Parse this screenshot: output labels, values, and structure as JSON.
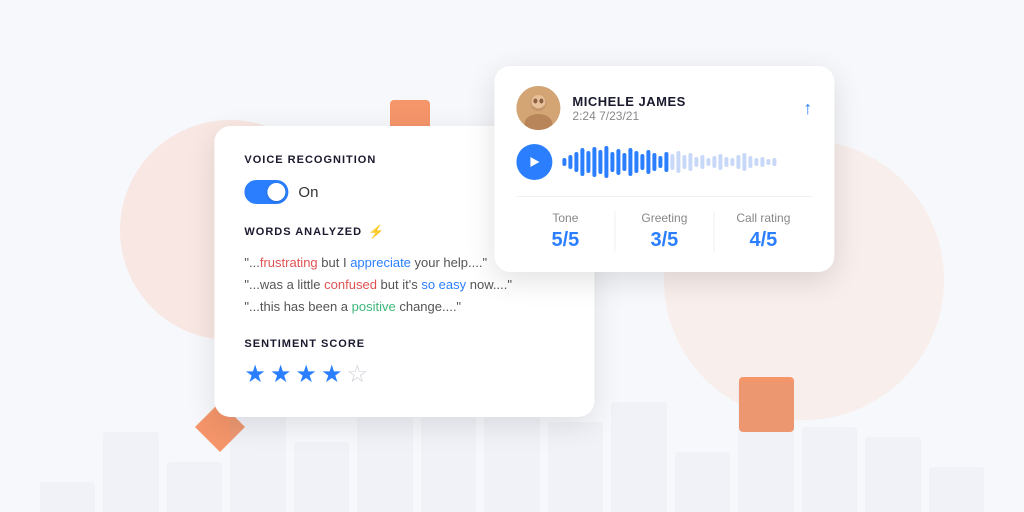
{
  "background": {
    "bars": [
      30,
      80,
      50,
      120,
      70,
      160,
      100,
      140,
      90,
      110,
      60,
      130,
      85,
      75,
      45
    ]
  },
  "voice_card": {
    "title": "VOICE RECOGNITION",
    "toggle_state": "on",
    "toggle_label": "On",
    "words_section_title": "WORDS ANALYZED",
    "words": [
      {
        "id": 0,
        "text": "\"...frustrating but I appreciate your help....\""
      },
      {
        "id": 1,
        "text": "\"...was a little confused but it's so easy now....\""
      },
      {
        "id": 2,
        "text": "\"...this has been a positive change....\""
      }
    ],
    "sentiment_title": "SENTIMENT SCORE",
    "stars": [
      true,
      true,
      true,
      true,
      false
    ]
  },
  "audio_card": {
    "user_name": "MICHELE JAMES",
    "user_meta": "2:24  7/23/21",
    "share_icon": "↑",
    "metrics": [
      {
        "label": "Tone",
        "value": "5/5"
      },
      {
        "label": "Greeting",
        "value": "3/5"
      },
      {
        "label": "Call rating",
        "value": "4/5"
      }
    ]
  }
}
